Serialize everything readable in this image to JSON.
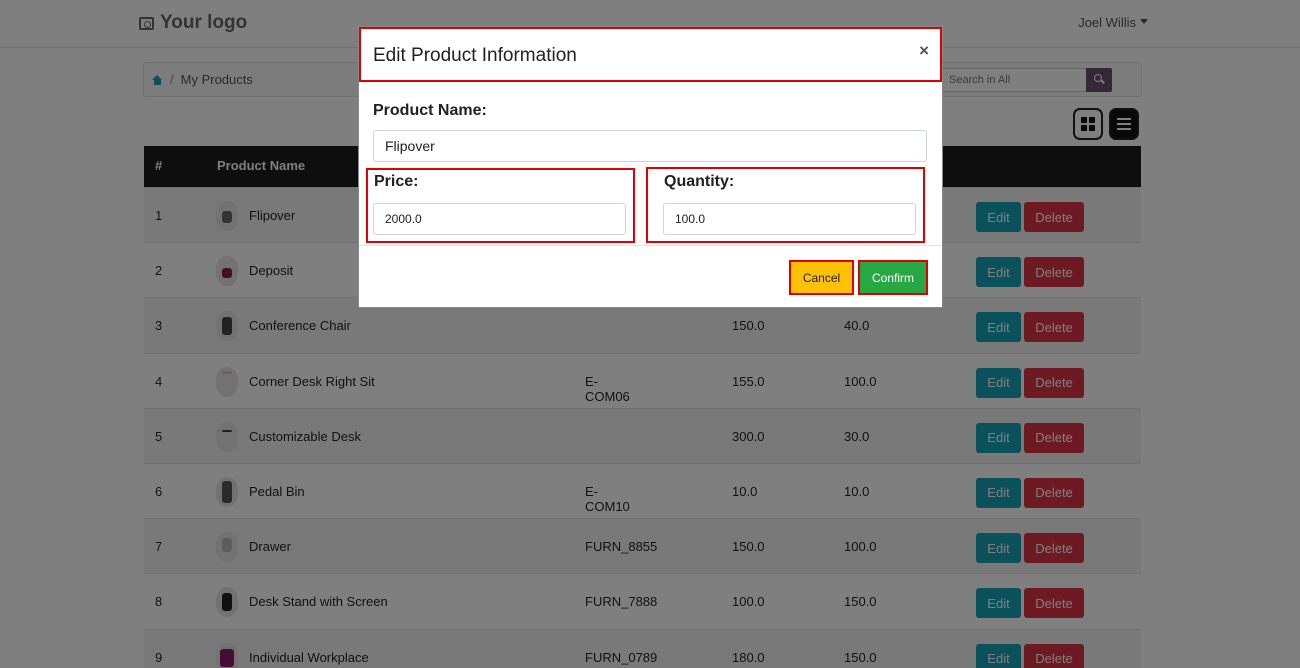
{
  "navbar": {
    "logo_text": "Your logo",
    "user_name": "Joel Willis"
  },
  "breadcrumb": {
    "current": "My Products"
  },
  "search": {
    "placeholder": "Search in All"
  },
  "table": {
    "headers": {
      "num": "#",
      "name": "Product Name"
    },
    "rows": [
      {
        "num": "1",
        "name": "Flipover",
        "ref": "",
        "price": "",
        "qty": ""
      },
      {
        "num": "2",
        "name": "Deposit",
        "ref": "",
        "price": "",
        "qty": ""
      },
      {
        "num": "3",
        "name": "Conference Chair",
        "ref": "",
        "price": "150.0",
        "qty": "40.0"
      },
      {
        "num": "4",
        "name": "Corner Desk Right Sit",
        "ref": "E-COM06",
        "price": "155.0",
        "qty": "100.0"
      },
      {
        "num": "5",
        "name": "Customizable Desk",
        "ref": "",
        "price": "300.0",
        "qty": "30.0"
      },
      {
        "num": "6",
        "name": "Pedal Bin",
        "ref": "E-COM10",
        "price": "10.0",
        "qty": "10.0"
      },
      {
        "num": "7",
        "name": "Drawer",
        "ref": "FURN_8855",
        "price": "150.0",
        "qty": "100.0"
      },
      {
        "num": "8",
        "name": "Desk Stand with Screen",
        "ref": "FURN_7888",
        "price": "100.0",
        "qty": "150.0"
      },
      {
        "num": "9",
        "name": "Individual Workplace",
        "ref": "FURN_0789",
        "price": "180.0",
        "qty": "150.0"
      }
    ],
    "edit_label": "Edit",
    "delete_label": "Delete"
  },
  "modal": {
    "title": "Edit Product Information",
    "close_glyph": "×",
    "product_name_label": "Product Name:",
    "product_name_value": "Flipover",
    "price_label": "Price:",
    "price_value": "2000.0",
    "quantity_label": "Quantity:",
    "quantity_value": "100.0",
    "cancel_label": "Cancel",
    "confirm_label": "Confirm"
  },
  "colors": {
    "edit": "#17a2b8",
    "delete": "#dc3545",
    "cancel": "#ffc107",
    "confirm": "#28a745",
    "highlight": "#e00000"
  }
}
